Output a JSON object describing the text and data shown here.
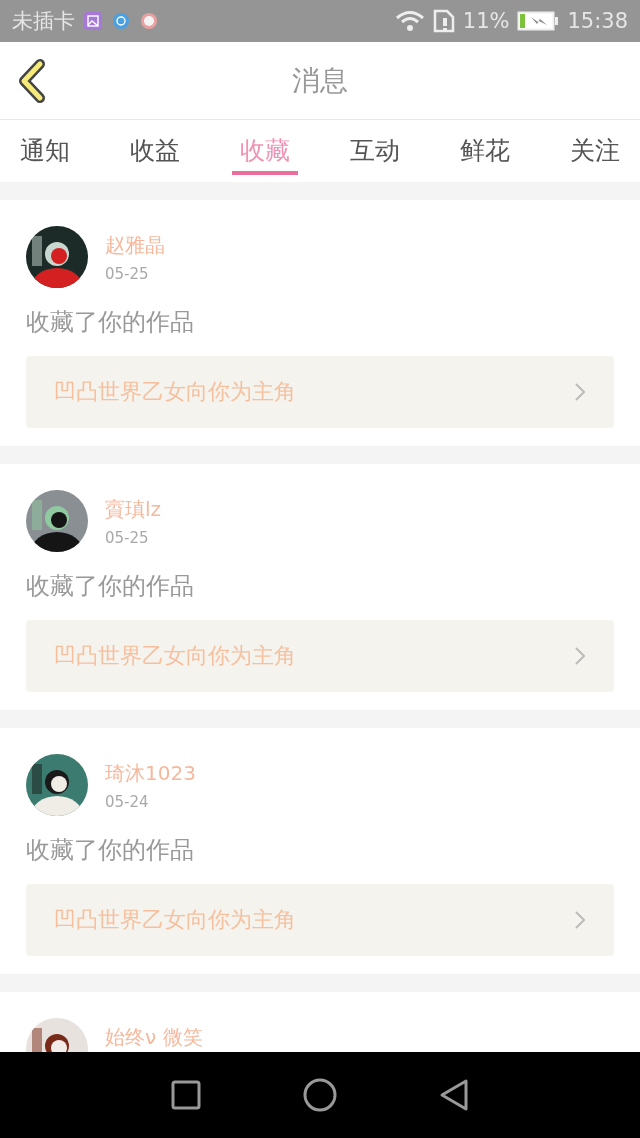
{
  "status_bar": {
    "carrier": "未插卡",
    "battery_percent": "11%",
    "time": "15:38"
  },
  "header": {
    "title": "消息"
  },
  "tabs": [
    {
      "label": "通知",
      "selected": false
    },
    {
      "label": "收益",
      "selected": false
    },
    {
      "label": "收藏",
      "selected": true
    },
    {
      "label": "互动",
      "selected": false
    },
    {
      "label": "鲜花",
      "selected": false
    },
    {
      "label": "关注",
      "selected": false
    }
  ],
  "items": [
    {
      "name": "赵雅晶",
      "date": "05-25",
      "action": "收藏了你的作品",
      "work": "凹凸世界乙女向你为主角"
    },
    {
      "name": "賨瑱lz",
      "date": "05-25",
      "action": "收藏了你的作品",
      "work": "凹凸世界乙女向你为主角"
    },
    {
      "name": "琦沐1023",
      "date": "05-24",
      "action": "收藏了你的作品",
      "work": "凹凸世界乙女向你为主角"
    },
    {
      "name": "始终ν 微笑"
    }
  ]
}
